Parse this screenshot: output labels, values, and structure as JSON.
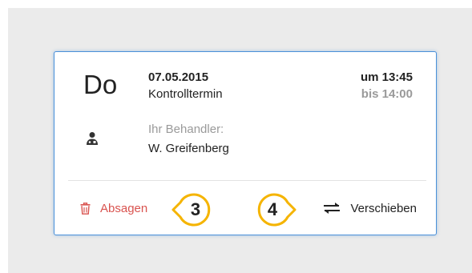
{
  "appointment": {
    "weekday": "Do",
    "date": "07.05.2015",
    "type": "Kontrolltermin",
    "time_start": "um 13:45",
    "time_end": "bis 14:00",
    "therapist_label": "Ihr Behandler:",
    "therapist_name": "W. Greifenberg"
  },
  "actions": {
    "cancel_label": "Absagen",
    "reschedule_label": "Verschieben"
  },
  "callouts": {
    "cancel_number": "3",
    "reschedule_number": "4"
  },
  "icons": {
    "cancel": "trash-icon",
    "reschedule": "swap-arrows-icon",
    "therapist": "doctor-icon"
  },
  "colors": {
    "accent_border": "#4a90d9",
    "danger": "#d9534f",
    "callout_ring": "#f5b400",
    "muted": "#9a9a9a"
  }
}
